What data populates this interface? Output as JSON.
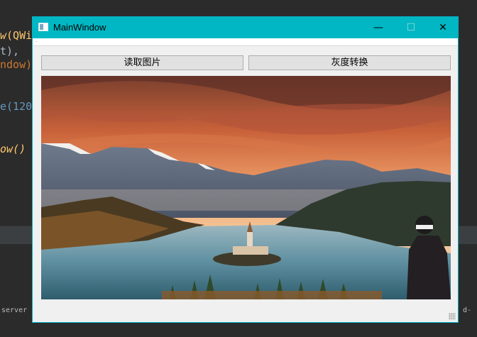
{
  "ide": {
    "code_lines": [
      {
        "a": "w",
        "b": "(QWi"
      },
      {
        "a": "",
        "b": "t),"
      },
      {
        "a": "",
        "b": "ndow)"
      },
      {
        "a": "",
        "b": ""
      },
      {
        "a": "",
        "b": "e(120"
      },
      {
        "a": "",
        "b": ""
      },
      {
        "a": "",
        "b": "ow()"
      }
    ],
    "console_left": "server '",
    "console_right": "d-"
  },
  "window": {
    "title": "MainWindow",
    "minimize_glyph": "—",
    "maximize_glyph": "☐",
    "close_glyph": "✕",
    "menu_marker": "·"
  },
  "toolbar": {
    "read_image_label": "读取图片",
    "grayscale_label": "灰度转换"
  },
  "image": {
    "icon": "landscape-photo"
  },
  "colors": {
    "titlebar": "#00b7c3",
    "window_bg": "#f0f0f0",
    "ide_bg": "#2b2b2b"
  }
}
